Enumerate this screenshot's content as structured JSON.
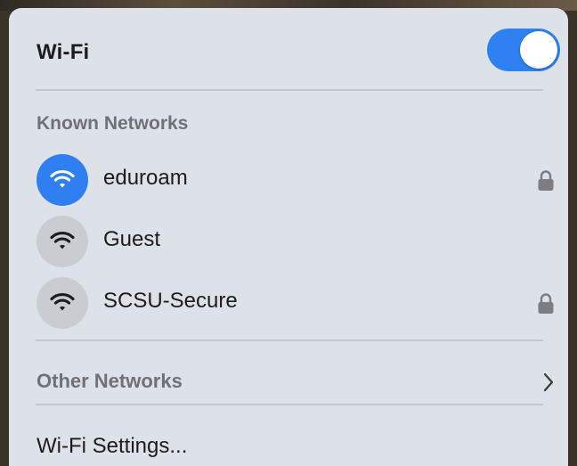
{
  "wifi": {
    "title": "Wi-Fi",
    "enabled": true,
    "accent_color": "#2f80f0"
  },
  "known_networks": {
    "label": "Known Networks",
    "items": [
      {
        "name": "eduroam",
        "connected": true,
        "secured": true,
        "icon": "wifi-icon"
      },
      {
        "name": "Guest",
        "connected": false,
        "secured": false,
        "icon": "wifi-icon"
      },
      {
        "name": "SCSU-Secure",
        "connected": false,
        "secured": true,
        "icon": "wifi-icon"
      }
    ]
  },
  "other_networks": {
    "label": "Other Networks",
    "icon": "chevron-right-icon"
  },
  "settings": {
    "label": "Wi-Fi Settings..."
  }
}
